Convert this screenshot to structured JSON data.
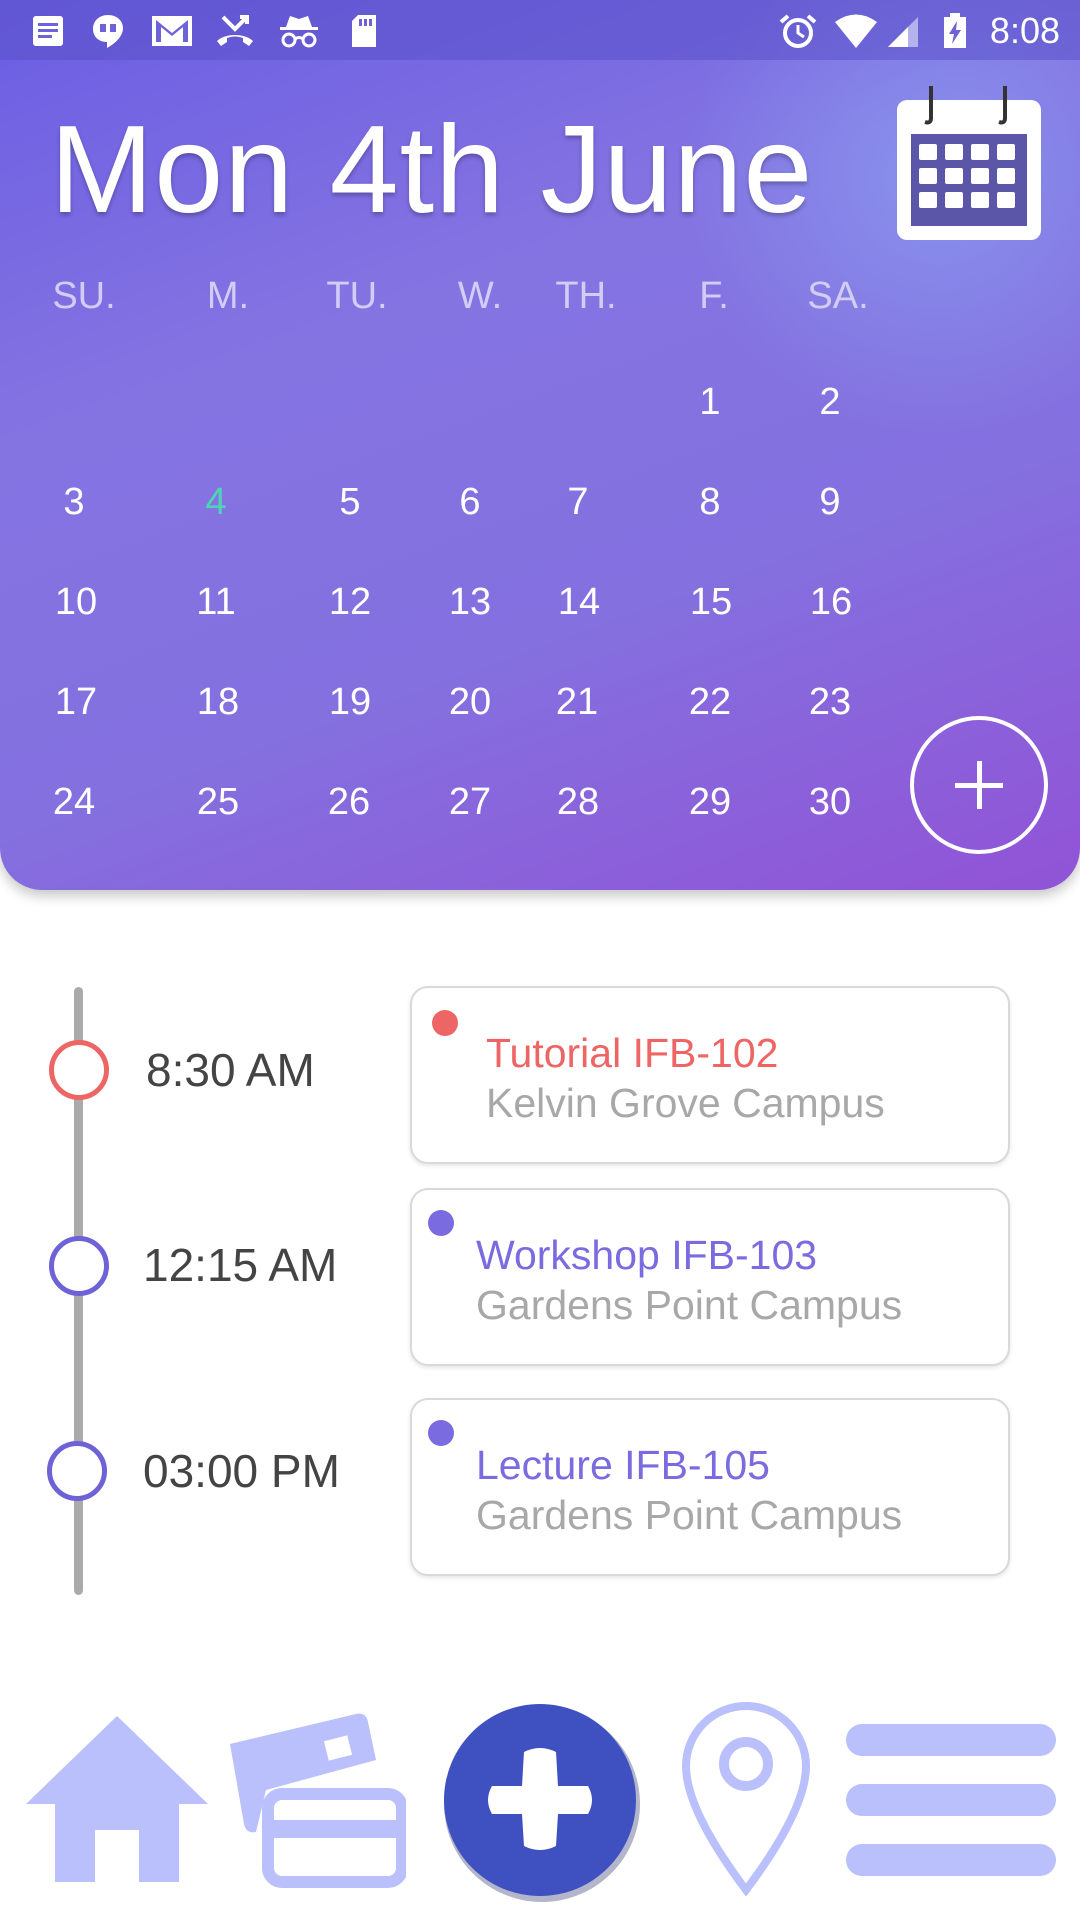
{
  "status_bar": {
    "time": "8:08",
    "left_icons": [
      "notes-icon",
      "hangouts-icon",
      "gmail-icon",
      "missed-call-icon",
      "incognito-icon",
      "sd-card-icon"
    ],
    "right_icons": [
      "alarm-icon",
      "wifi-icon",
      "cell-signal-icon",
      "battery-charging-icon"
    ]
  },
  "header": {
    "date_title": "Mon 4th June",
    "calendar_button_icon": "calendar-icon",
    "add_button_icon": "plus-icon"
  },
  "calendar": {
    "weekdays": [
      "SU.",
      "M.",
      "TU.",
      "W.",
      "TH.",
      "F.",
      "SA."
    ],
    "weeks": [
      [
        "",
        "",
        "",
        "",
        "",
        "1",
        "2"
      ],
      [
        "3",
        "4",
        "5",
        "6",
        "7",
        "8",
        "9"
      ],
      [
        "10",
        "11",
        "12",
        "13",
        "14",
        "15",
        "16"
      ],
      [
        "17",
        "18",
        "19",
        "20",
        "21",
        "22",
        "23"
      ],
      [
        "24",
        "25",
        "26",
        "27",
        "28",
        "29",
        "30"
      ]
    ],
    "today": "4",
    "today_color": "#4ed4b5"
  },
  "events": [
    {
      "time": "8:30 AM",
      "title": "Tutorial IFB-102",
      "location": "Kelvin Grove Campus",
      "color": "#ee6565"
    },
    {
      "time": "12:15 AM",
      "title": "Workshop IFB-103",
      "location": "Gardens Point Campus",
      "color": "#7a6be0"
    },
    {
      "time": "03:00 PM",
      "title": "Lecture IFB-105",
      "location": "Gardens Point Campus",
      "color": "#7a6be0"
    }
  ],
  "bottom_nav": {
    "items": [
      "home-icon",
      "cards-icon",
      "add-icon",
      "location-pin-icon",
      "menu-icon"
    ],
    "accent": "#3f51c0",
    "inactive": "#b9c0fb"
  }
}
